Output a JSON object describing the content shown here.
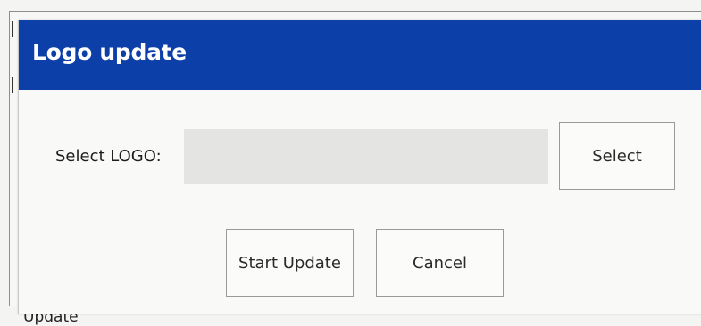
{
  "dialog": {
    "title": "Logo update",
    "select_label": "Select LOGO:",
    "logo_field_value": "",
    "select_button": "Select",
    "start_update_button": "Start Update",
    "cancel_button": "Cancel"
  },
  "background": {
    "bottom_label": "Update"
  },
  "colors": {
    "titlebar": "#0c3fa8",
    "field": "#e4e4e2"
  }
}
